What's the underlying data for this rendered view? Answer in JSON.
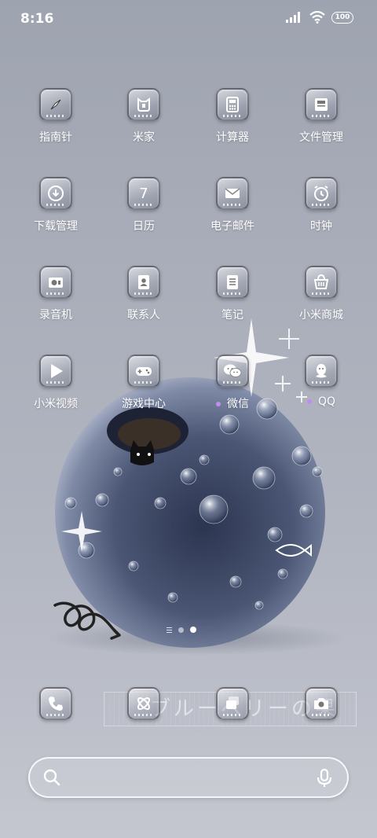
{
  "status_bar": {
    "time": "8:16",
    "battery": "100"
  },
  "apps": [
    {
      "label": "指南针",
      "icon": "compass-icon"
    },
    {
      "label": "米家",
      "icon": "mijia-icon"
    },
    {
      "label": "计算器",
      "icon": "calculator-icon"
    },
    {
      "label": "文件管理",
      "icon": "file-manager-icon"
    },
    {
      "label": "下载管理",
      "icon": "download-icon"
    },
    {
      "label": "日历",
      "icon": "calendar-icon",
      "badge_text": "7"
    },
    {
      "label": "电子邮件",
      "icon": "mail-icon"
    },
    {
      "label": "时钟",
      "icon": "clock-icon"
    },
    {
      "label": "录音机",
      "icon": "recorder-icon"
    },
    {
      "label": "联系人",
      "icon": "contacts-icon"
    },
    {
      "label": "笔记",
      "icon": "notes-icon"
    },
    {
      "label": "小米商城",
      "icon": "shopping-bag-icon"
    },
    {
      "label": "小米视频",
      "icon": "play-icon"
    },
    {
      "label": "游戏中心",
      "icon": "gamepad-icon"
    },
    {
      "label": "微信",
      "icon": "wechat-icon",
      "new_dot": true
    },
    {
      "label": "QQ",
      "icon": "qq-penguin-icon",
      "new_dot": true
    }
  ],
  "dock": [
    {
      "name": "phone",
      "icon": "phone-icon"
    },
    {
      "name": "gallery",
      "icon": "gallery-icon"
    },
    {
      "name": "messages",
      "icon": "messages-icon"
    },
    {
      "name": "camera",
      "icon": "camera-icon"
    }
  ],
  "wallpaper_text": "ブルーベリーの果",
  "search": {
    "placeholder": ""
  },
  "colors": {
    "new_dot": "#c48cf0",
    "background": "#a9adb9"
  }
}
